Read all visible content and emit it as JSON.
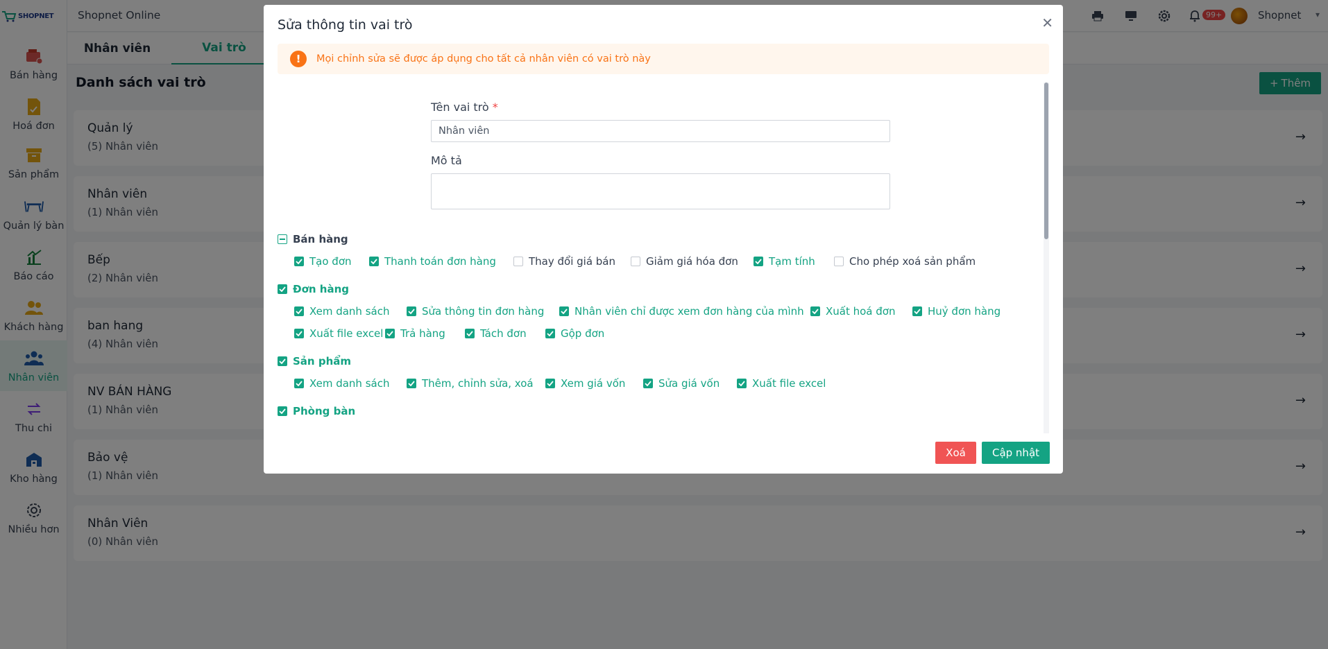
{
  "app": {
    "title": "Shopnet Online",
    "logo_text": "SHOPNET",
    "user_name": "Shopnet",
    "notification_badge": "99+"
  },
  "sidebar": {
    "items": [
      {
        "label": "Bán hàng",
        "icon": "cashier-icon"
      },
      {
        "label": "Hoá đơn",
        "icon": "invoice-icon"
      },
      {
        "label": "Sản phẩm",
        "icon": "box-icon"
      },
      {
        "label": "Quản lý bàn",
        "icon": "table-icon"
      },
      {
        "label": "Báo cáo",
        "icon": "chart-icon"
      },
      {
        "label": "Khách hàng",
        "icon": "customers-icon"
      },
      {
        "label": "Nhân viên",
        "icon": "staff-icon"
      },
      {
        "label": "Thu chi",
        "icon": "transfer-icon"
      },
      {
        "label": "Kho hàng",
        "icon": "warehouse-icon"
      },
      {
        "label": "Nhiều hơn",
        "icon": "gear-icon"
      }
    ],
    "active": "Nhân viên"
  },
  "tabs": [
    {
      "label": "Nhân viên"
    },
    {
      "label": "Vai trò"
    }
  ],
  "list": {
    "title": "Danh sách vai trò",
    "add_label": "Thêm",
    "roles": [
      {
        "name": "Quản lý",
        "count": "(5) Nhân viên"
      },
      {
        "name": "Nhân viên",
        "count": "(1) Nhân viên"
      },
      {
        "name": "Bếp",
        "count": "(2) Nhân viên"
      },
      {
        "name": "ban hang",
        "count": "(4) Nhân viên"
      },
      {
        "name": "NV BÁN HÀNG",
        "count": "(1) Nhân viên"
      },
      {
        "name": "Bảo vệ",
        "count": "(1) Nhân viên"
      },
      {
        "name": "Nhân Viên",
        "count": "(0) Nhân viên"
      }
    ]
  },
  "modal": {
    "title": "Sửa thông tin vai trò",
    "alert": "Mọi chỉnh sửa sẽ được áp dụng cho tất cả nhân viên có vai trò này",
    "name_label": "Tên vai trò",
    "required_mark": "*",
    "name_value": "Nhân viên",
    "desc_label": "Mô tả",
    "desc_value": "",
    "delete_label": "Xoá",
    "update_label": "Cập nhật",
    "groups": [
      {
        "label": "Bán hàng",
        "state": "indeterminate",
        "perms": [
          {
            "label": "Tạo đơn",
            "checked": true
          },
          {
            "label": "Thanh toán đơn hàng",
            "checked": true
          },
          {
            "label": "Thay đổi giá bán",
            "checked": false
          },
          {
            "label": "Giảm giá hóa đơn",
            "checked": false
          },
          {
            "label": "Tạm tính",
            "checked": true
          },
          {
            "label": "Cho phép xoá sản phẩm",
            "checked": false
          }
        ]
      },
      {
        "label": "Đơn hàng",
        "state": "checked",
        "perms": [
          {
            "label": "Xem danh sách",
            "checked": true
          },
          {
            "label": "Sửa thông tin đơn hàng",
            "checked": true
          },
          {
            "label": "Nhân viên chỉ được xem đơn hàng của mình",
            "checked": true
          },
          {
            "label": "Xuất hoá đơn",
            "checked": true
          },
          {
            "label": "Huỷ đơn hàng",
            "checked": true
          },
          {
            "label": "Xuất file excel",
            "checked": true
          },
          {
            "label": "Trả hàng",
            "checked": true
          },
          {
            "label": "Tách đơn",
            "checked": true
          },
          {
            "label": "Gộp đơn",
            "checked": true
          }
        ]
      },
      {
        "label": "Sản phẩm",
        "state": "checked",
        "perms": [
          {
            "label": "Xem danh sách",
            "checked": true
          },
          {
            "label": "Thêm, chỉnh sửa, xoá",
            "checked": true
          },
          {
            "label": "Xem giá vốn",
            "checked": true
          },
          {
            "label": "Sửa giá vốn",
            "checked": true
          },
          {
            "label": "Xuất file excel",
            "checked": true
          }
        ]
      },
      {
        "label": "Phòng bàn",
        "state": "checked",
        "perms": []
      }
    ]
  },
  "colors": {
    "accent": "#14a383",
    "danger": "#f05454",
    "warning": "#f97316"
  }
}
